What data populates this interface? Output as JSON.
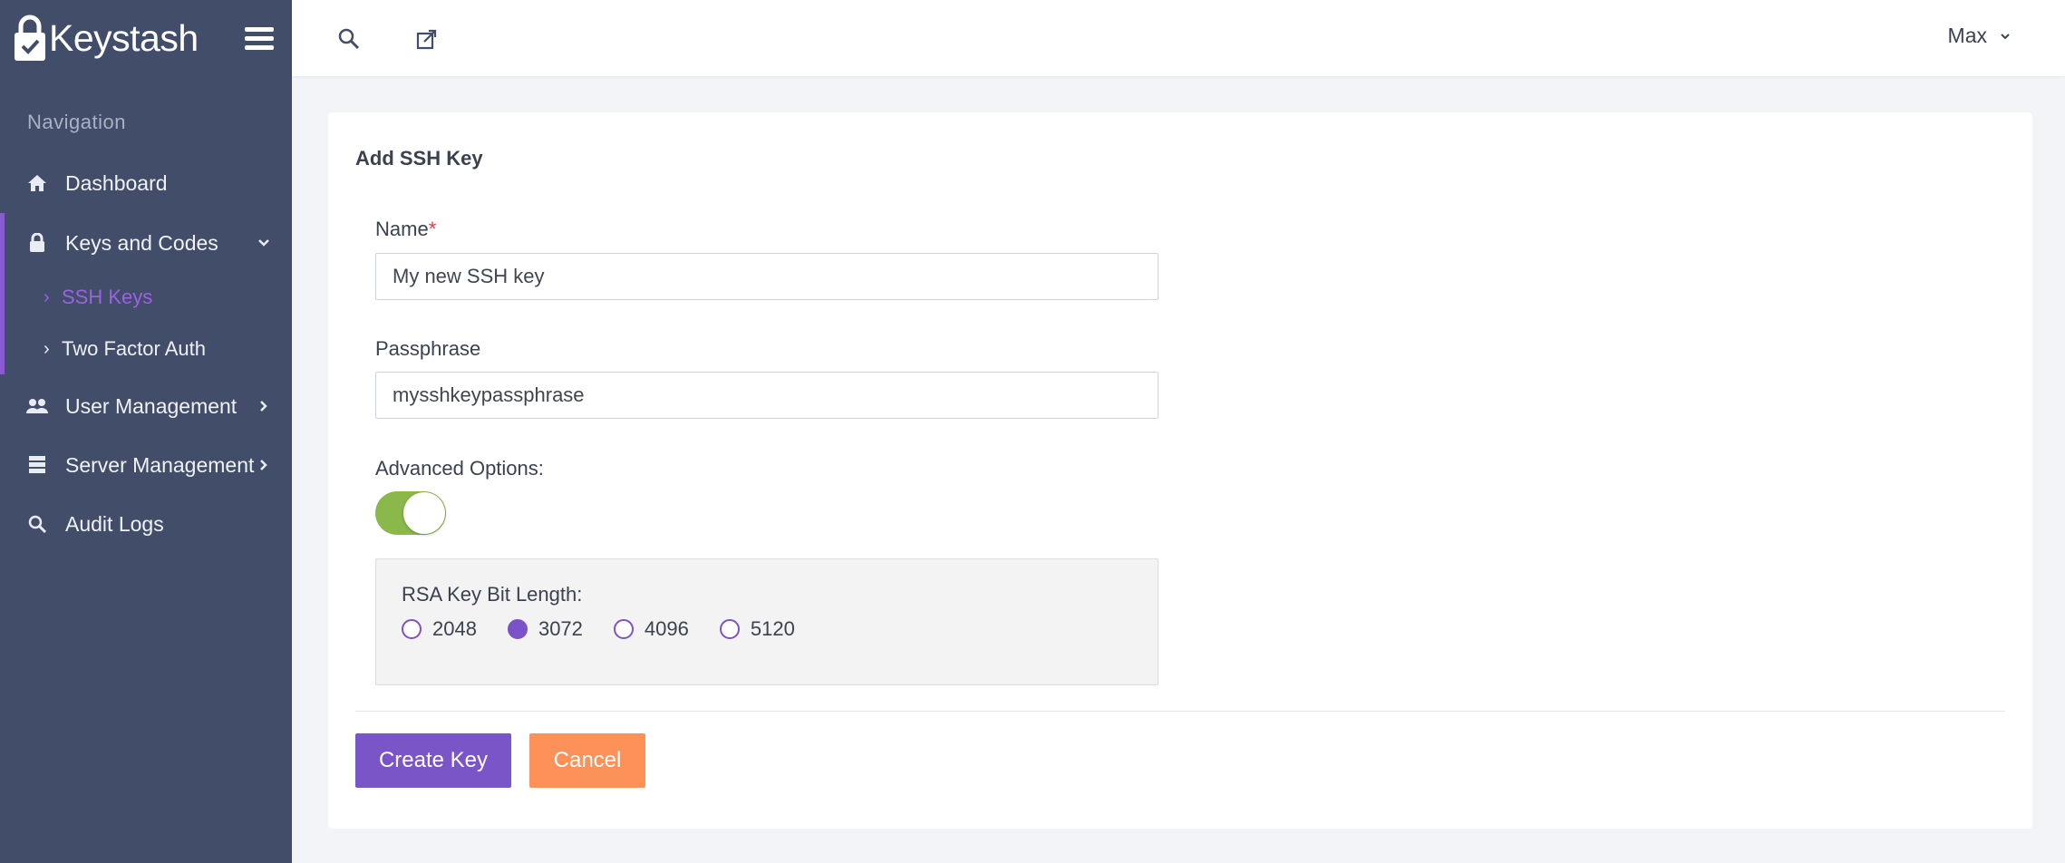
{
  "brand": {
    "name": "Keystash"
  },
  "sidebar": {
    "header": "Navigation",
    "items": [
      {
        "label": "Dashboard",
        "icon": "home-icon"
      },
      {
        "label": "Keys and Codes",
        "icon": "lock-icon",
        "expanded": true,
        "children": [
          {
            "label": "SSH Keys",
            "active": true
          },
          {
            "label": "Two Factor Auth",
            "active": false
          }
        ]
      },
      {
        "label": "User Management",
        "icon": "users-icon"
      },
      {
        "label": "Server Management",
        "icon": "server-icon"
      },
      {
        "label": "Audit Logs",
        "icon": "search-log-icon"
      }
    ]
  },
  "topbar": {
    "user": "Max"
  },
  "form": {
    "title": "Add SSH Key",
    "name_label": "Name",
    "required_mark": "*",
    "name_value": "My new SSH key",
    "passphrase_label": "Passphrase",
    "passphrase_value": "mysshkeypassphrase",
    "advanced_label": "Advanced Options:",
    "advanced_enabled": true,
    "bits_label": "RSA Key Bit Length:",
    "bit_options": [
      "2048",
      "3072",
      "4096",
      "5120"
    ],
    "selected_bits": "3072",
    "create_label": "Create Key",
    "cancel_label": "Cancel"
  },
  "colors": {
    "sidebar": "#414d69",
    "accent": "#7a55c7",
    "cancel": "#fd915a",
    "toggle": "#8bb84b"
  }
}
